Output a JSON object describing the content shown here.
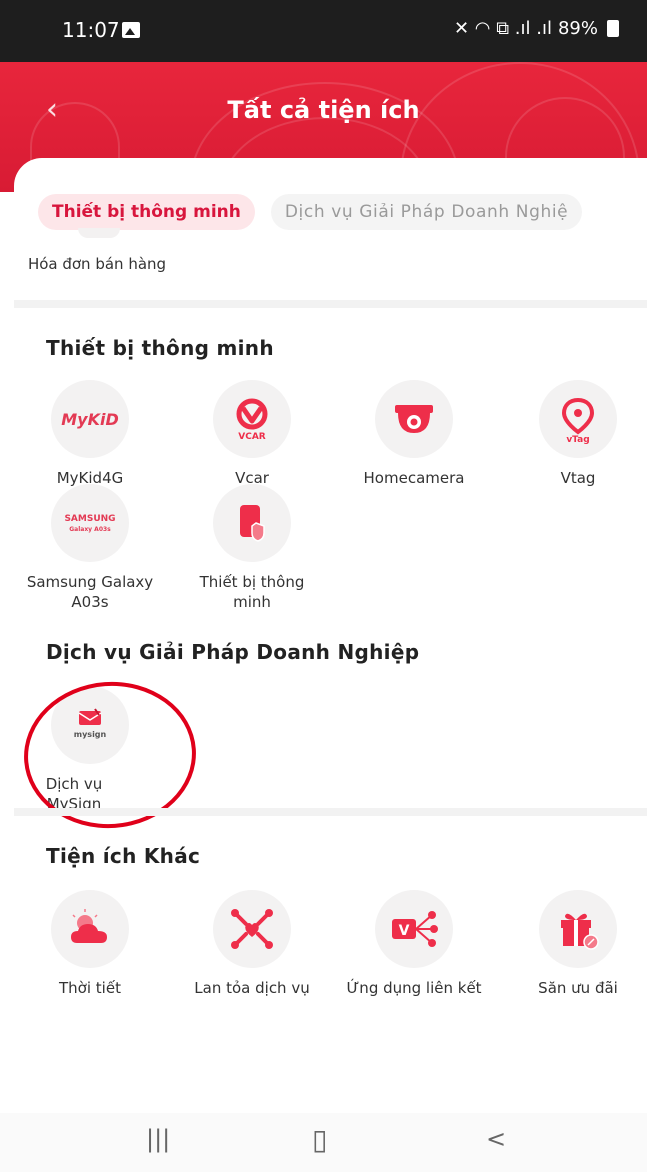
{
  "status_bar": {
    "time": "11:07",
    "right_icons": "✕ ◠ ⧉ .ıl .ıl",
    "battery": "89%"
  },
  "header": {
    "title": "Tất cả tiện ích",
    "back_icon": "chevron-left-icon"
  },
  "tabs": [
    {
      "label": "Thiết bị thông minh",
      "active": true
    },
    {
      "label": "Dịch vụ Giải Pháp Doanh Nghiệ",
      "active": false
    }
  ],
  "partial_item": {
    "label": "Hóa đơn bán hàng"
  },
  "sections": {
    "smart_devices": {
      "title": "Thiết bị thông minh",
      "items": [
        {
          "label": "MyKid4G",
          "icon": "mykid-logo-icon"
        },
        {
          "label": "Vcar",
          "icon": "vcar-icon"
        },
        {
          "label": "Homecamera",
          "icon": "camera-icon"
        },
        {
          "label": "Vtag",
          "icon": "vtag-icon"
        },
        {
          "label": "Samsung Galaxy A03s",
          "icon": "samsung-logo-icon"
        },
        {
          "label": "Thiết bị thông minh",
          "icon": "smart-device-icon"
        }
      ]
    },
    "business": {
      "title": "Dịch vụ Giải Pháp Doanh Nghiệp",
      "items": [
        {
          "label": "Dịch vụ MySign",
          "icon": "mysign-logo-icon"
        }
      ]
    },
    "other": {
      "title": "Tiện ích Khác",
      "items": [
        {
          "label": "Thời tiết",
          "icon": "weather-icon"
        },
        {
          "label": "Lan tỏa dịch vụ",
          "icon": "share-heart-icon"
        },
        {
          "label": "Ứng dụng liên kết",
          "icon": "linked-app-icon"
        },
        {
          "label": "Săn ưu đãi",
          "icon": "gift-icon"
        }
      ]
    }
  },
  "logo_text": {
    "mykid": "MyKiD",
    "vcar": "VCAR",
    "vtag": "vTag",
    "samsung": "SAMSUNG",
    "samsung_sub": "Galaxy A03s",
    "mysign": "mysign",
    "linked_v": "V"
  },
  "nav_bar": {
    "recents": "|||",
    "home": "▯",
    "back": "<"
  },
  "colors": {
    "brand_red": "#e8263c",
    "accent_text": "#d8163d",
    "icon_bg": "#f3f2f2",
    "icon_red": "#ee2e4a",
    "annotation": "#e0001a"
  }
}
